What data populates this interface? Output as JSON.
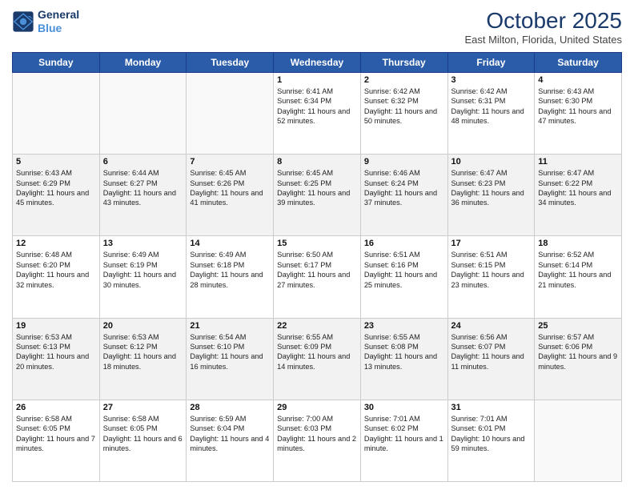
{
  "header": {
    "logo_line1": "General",
    "logo_line2": "Blue",
    "month": "October 2025",
    "location": "East Milton, Florida, United States"
  },
  "weekdays": [
    "Sunday",
    "Monday",
    "Tuesday",
    "Wednesday",
    "Thursday",
    "Friday",
    "Saturday"
  ],
  "weeks": [
    [
      {
        "day": "",
        "info": ""
      },
      {
        "day": "",
        "info": ""
      },
      {
        "day": "",
        "info": ""
      },
      {
        "day": "1",
        "info": "Sunrise: 6:41 AM\nSunset: 6:34 PM\nDaylight: 11 hours and 52 minutes."
      },
      {
        "day": "2",
        "info": "Sunrise: 6:42 AM\nSunset: 6:32 PM\nDaylight: 11 hours and 50 minutes."
      },
      {
        "day": "3",
        "info": "Sunrise: 6:42 AM\nSunset: 6:31 PM\nDaylight: 11 hours and 48 minutes."
      },
      {
        "day": "4",
        "info": "Sunrise: 6:43 AM\nSunset: 6:30 PM\nDaylight: 11 hours and 47 minutes."
      }
    ],
    [
      {
        "day": "5",
        "info": "Sunrise: 6:43 AM\nSunset: 6:29 PM\nDaylight: 11 hours and 45 minutes."
      },
      {
        "day": "6",
        "info": "Sunrise: 6:44 AM\nSunset: 6:27 PM\nDaylight: 11 hours and 43 minutes."
      },
      {
        "day": "7",
        "info": "Sunrise: 6:45 AM\nSunset: 6:26 PM\nDaylight: 11 hours and 41 minutes."
      },
      {
        "day": "8",
        "info": "Sunrise: 6:45 AM\nSunset: 6:25 PM\nDaylight: 11 hours and 39 minutes."
      },
      {
        "day": "9",
        "info": "Sunrise: 6:46 AM\nSunset: 6:24 PM\nDaylight: 11 hours and 37 minutes."
      },
      {
        "day": "10",
        "info": "Sunrise: 6:47 AM\nSunset: 6:23 PM\nDaylight: 11 hours and 36 minutes."
      },
      {
        "day": "11",
        "info": "Sunrise: 6:47 AM\nSunset: 6:22 PM\nDaylight: 11 hours and 34 minutes."
      }
    ],
    [
      {
        "day": "12",
        "info": "Sunrise: 6:48 AM\nSunset: 6:20 PM\nDaylight: 11 hours and 32 minutes."
      },
      {
        "day": "13",
        "info": "Sunrise: 6:49 AM\nSunset: 6:19 PM\nDaylight: 11 hours and 30 minutes."
      },
      {
        "day": "14",
        "info": "Sunrise: 6:49 AM\nSunset: 6:18 PM\nDaylight: 11 hours and 28 minutes."
      },
      {
        "day": "15",
        "info": "Sunrise: 6:50 AM\nSunset: 6:17 PM\nDaylight: 11 hours and 27 minutes."
      },
      {
        "day": "16",
        "info": "Sunrise: 6:51 AM\nSunset: 6:16 PM\nDaylight: 11 hours and 25 minutes."
      },
      {
        "day": "17",
        "info": "Sunrise: 6:51 AM\nSunset: 6:15 PM\nDaylight: 11 hours and 23 minutes."
      },
      {
        "day": "18",
        "info": "Sunrise: 6:52 AM\nSunset: 6:14 PM\nDaylight: 11 hours and 21 minutes."
      }
    ],
    [
      {
        "day": "19",
        "info": "Sunrise: 6:53 AM\nSunset: 6:13 PM\nDaylight: 11 hours and 20 minutes."
      },
      {
        "day": "20",
        "info": "Sunrise: 6:53 AM\nSunset: 6:12 PM\nDaylight: 11 hours and 18 minutes."
      },
      {
        "day": "21",
        "info": "Sunrise: 6:54 AM\nSunset: 6:10 PM\nDaylight: 11 hours and 16 minutes."
      },
      {
        "day": "22",
        "info": "Sunrise: 6:55 AM\nSunset: 6:09 PM\nDaylight: 11 hours and 14 minutes."
      },
      {
        "day": "23",
        "info": "Sunrise: 6:55 AM\nSunset: 6:08 PM\nDaylight: 11 hours and 13 minutes."
      },
      {
        "day": "24",
        "info": "Sunrise: 6:56 AM\nSunset: 6:07 PM\nDaylight: 11 hours and 11 minutes."
      },
      {
        "day": "25",
        "info": "Sunrise: 6:57 AM\nSunset: 6:06 PM\nDaylight: 11 hours and 9 minutes."
      }
    ],
    [
      {
        "day": "26",
        "info": "Sunrise: 6:58 AM\nSunset: 6:05 PM\nDaylight: 11 hours and 7 minutes."
      },
      {
        "day": "27",
        "info": "Sunrise: 6:58 AM\nSunset: 6:05 PM\nDaylight: 11 hours and 6 minutes."
      },
      {
        "day": "28",
        "info": "Sunrise: 6:59 AM\nSunset: 6:04 PM\nDaylight: 11 hours and 4 minutes."
      },
      {
        "day": "29",
        "info": "Sunrise: 7:00 AM\nSunset: 6:03 PM\nDaylight: 11 hours and 2 minutes."
      },
      {
        "day": "30",
        "info": "Sunrise: 7:01 AM\nSunset: 6:02 PM\nDaylight: 11 hours and 1 minute."
      },
      {
        "day": "31",
        "info": "Sunrise: 7:01 AM\nSunset: 6:01 PM\nDaylight: 10 hours and 59 minutes."
      },
      {
        "day": "",
        "info": ""
      }
    ]
  ]
}
